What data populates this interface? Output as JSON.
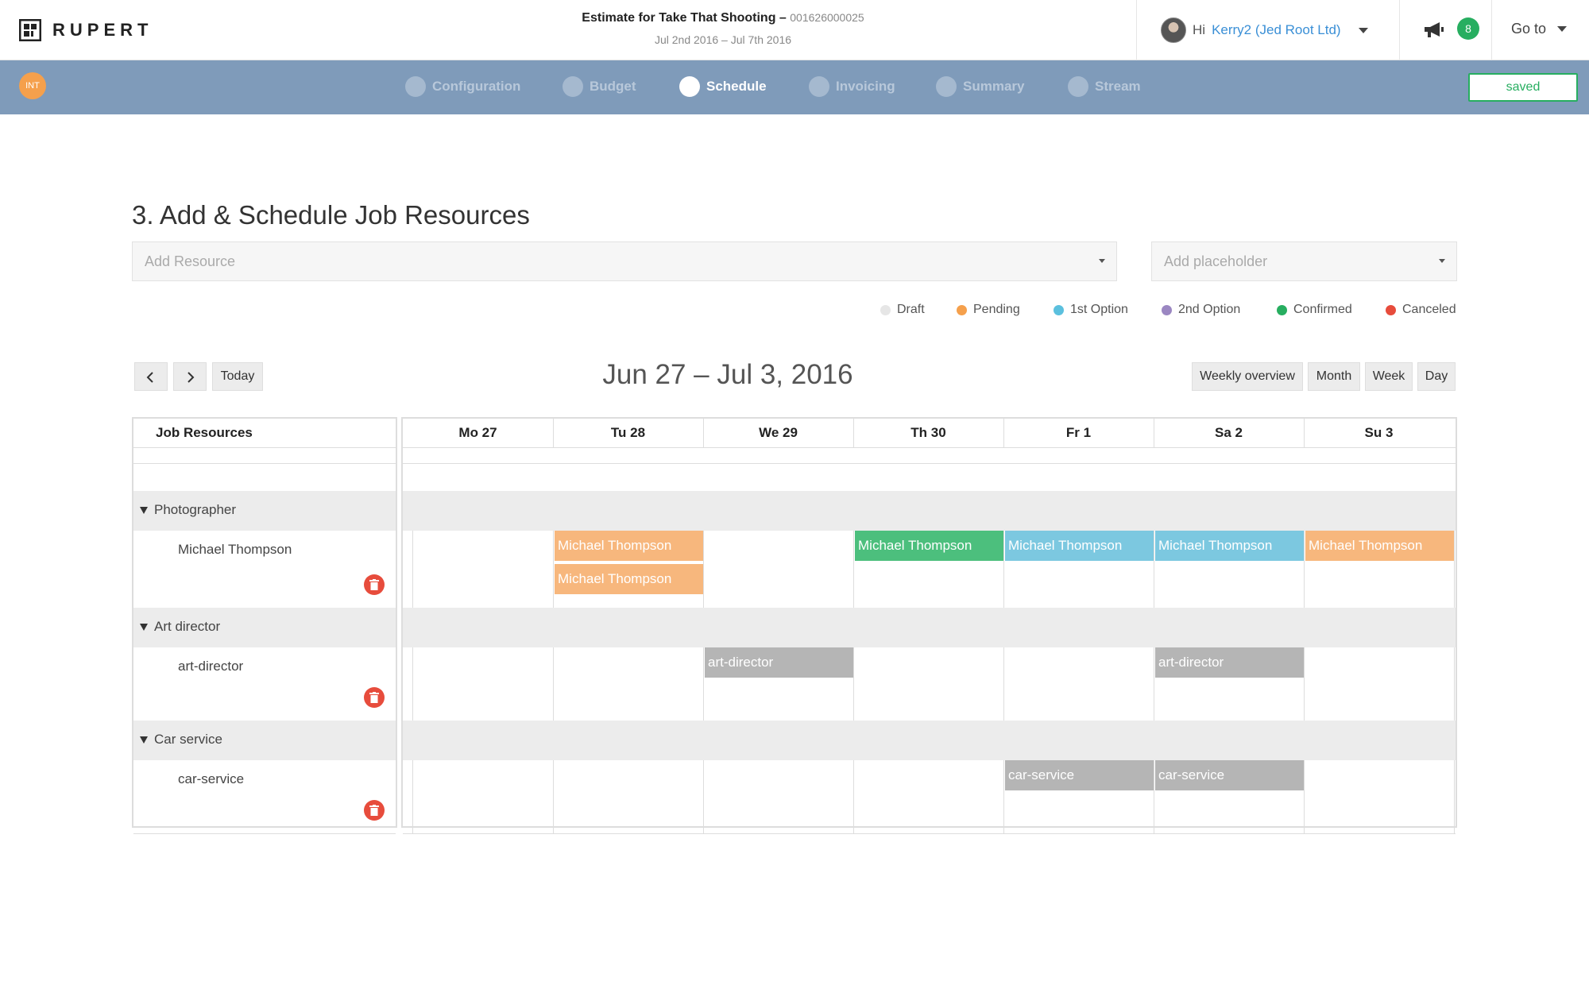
{
  "app": {
    "logo_text": "RUPERT"
  },
  "header": {
    "title_main": "Estimate for Take That Shooting –",
    "title_code": "001626000025",
    "dates": "Jul 2nd 2016 – Jul 7th 2016",
    "greeting": "Hi",
    "user_name": "Kerry2 (Jed Root Ltd)",
    "notification_count": "8",
    "goto_label": "Go to"
  },
  "steps_bar": {
    "badge": "INT",
    "steps": [
      {
        "label": "Configuration",
        "active": false
      },
      {
        "label": "Budget",
        "active": false
      },
      {
        "label": "Schedule",
        "active": true
      },
      {
        "label": "Invoicing",
        "active": false
      },
      {
        "label": "Summary",
        "active": false
      },
      {
        "label": "Stream",
        "active": false
      }
    ],
    "saved_label": "saved"
  },
  "page": {
    "title": "3. Add & Schedule Job Resources",
    "add_resource_placeholder": "Add Resource",
    "add_placeholder_placeholder": "Add placeholder"
  },
  "legend": [
    {
      "label": "Draft",
      "color": "#e6e6e6"
    },
    {
      "label": "Pending",
      "color": "#f5a04c"
    },
    {
      "label": "1st Option",
      "color": "#5bc0de"
    },
    {
      "label": "2nd Option",
      "color": "#9b87c2"
    },
    {
      "label": "Confirmed",
      "color": "#27ae60"
    },
    {
      "label": "Canceled",
      "color": "#e74c3c"
    }
  ],
  "calendar": {
    "nav": {
      "prev_icon": "chevron-left-icon",
      "next_icon": "chevron-right-icon",
      "today": "Today"
    },
    "range_title": "Jun 27 – Jul 3, 2016",
    "views": [
      "Weekly overview",
      "Month",
      "Week",
      "Day"
    ],
    "resources_header": "Job Resources",
    "days": [
      "Mo 27",
      "Tu 28",
      "We 29",
      "Th 30",
      "Fr 1",
      "Sa 2",
      "Su 3"
    ],
    "groups": [
      {
        "label": "Photographer",
        "resource": "Michael Thompson",
        "events": [
          {
            "day": 1,
            "slot": 0,
            "label": "Michael Thompson",
            "status": "Pending"
          },
          {
            "day": 1,
            "slot": 1,
            "label": "Michael Thompson",
            "status": "Pending"
          },
          {
            "day": 3,
            "slot": 0,
            "label": "Michael Thompson",
            "status": "Confirmed"
          },
          {
            "day": 4,
            "slot": 0,
            "label": "Michael Thompson",
            "status": "1st Option"
          },
          {
            "day": 5,
            "slot": 0,
            "label": "Michael Thompson",
            "status": "1st Option"
          },
          {
            "day": 6,
            "slot": 0,
            "label": "Michael Thompson",
            "status": "Pending"
          }
        ]
      },
      {
        "label": "Art director",
        "resource": "art-director",
        "events": [
          {
            "day": 2,
            "slot": 0,
            "label": "art-director",
            "status": "Placeholder"
          },
          {
            "day": 5,
            "slot": 0,
            "label": "art-director",
            "status": "Placeholder"
          }
        ]
      },
      {
        "label": "Car service",
        "resource": "car-service",
        "events": [
          {
            "day": 4,
            "slot": 0,
            "label": "car-service",
            "status": "Placeholder"
          },
          {
            "day": 5,
            "slot": 0,
            "label": "car-service",
            "status": "Placeholder"
          }
        ]
      }
    ],
    "status_colors": {
      "Pending": "#f7b77d",
      "Confirmed": "#4cbf7d",
      "1st Option": "#7cc8e0",
      "Placeholder": "#b5b5b5"
    }
  }
}
